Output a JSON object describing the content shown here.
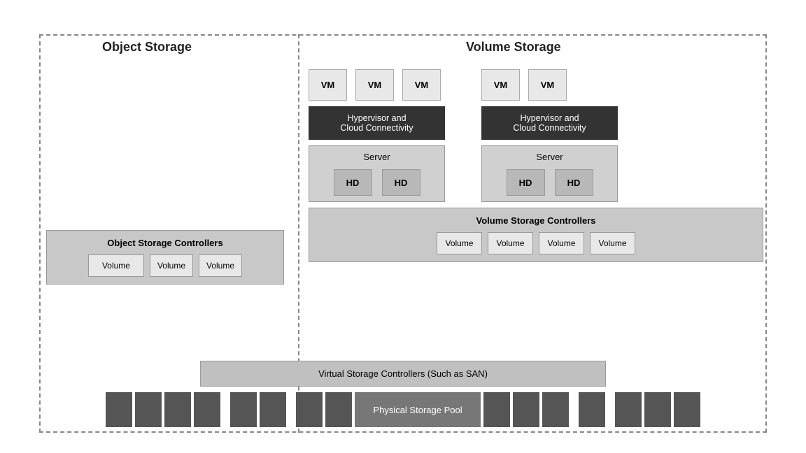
{
  "titles": {
    "object_storage": "Object Storage",
    "volume_storage": "Volume Storage"
  },
  "vm_labels": [
    "VM",
    "VM",
    "VM",
    "VM",
    "VM"
  ],
  "hypervisor_label": "Hypervisor and\nCloud Connectivity",
  "server_label": "Server",
  "hd_label": "HD",
  "object_controllers_label": "Object Storage Controllers",
  "volume_controllers_label": "Volume Storage Controllers",
  "volume_label": "Volume",
  "virtual_storage_label": "Virtual Storage Controllers (Such as SAN)",
  "physical_storage_label": "Physical Storage Pool"
}
